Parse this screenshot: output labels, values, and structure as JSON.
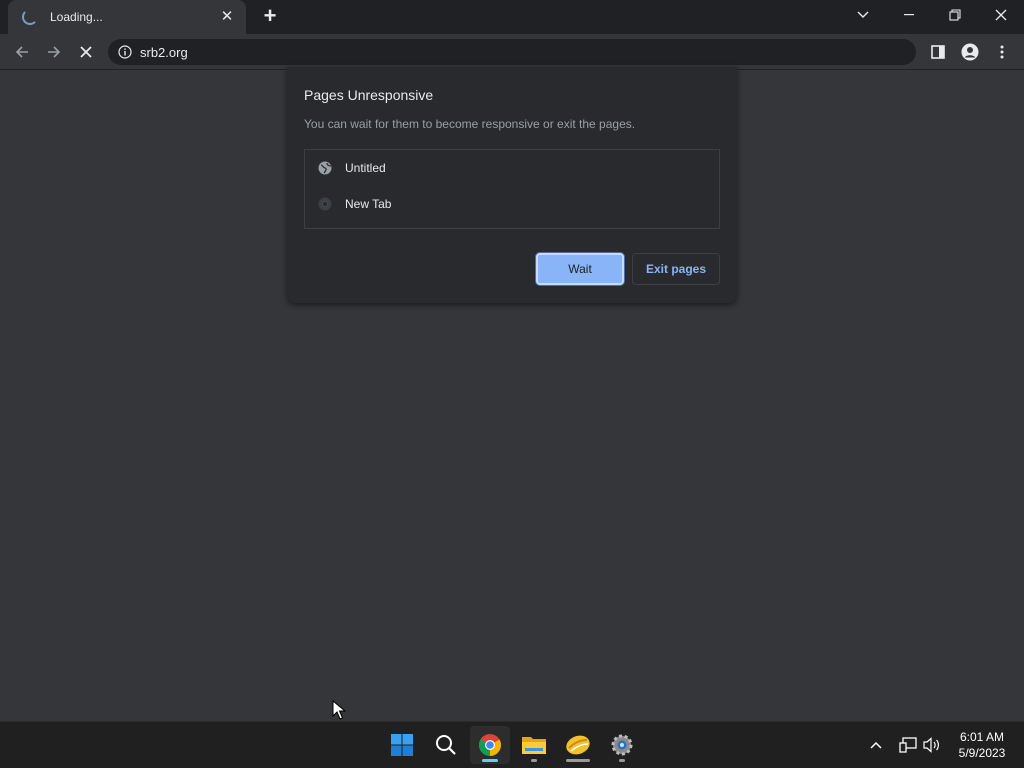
{
  "browser": {
    "tab": {
      "title": "Loading...",
      "close": "✕"
    },
    "new_tab": "+",
    "address": {
      "url": "srb2.org"
    }
  },
  "dialog": {
    "title": "Pages Unresponsive",
    "message": "You can wait for them to become responsive or exit the pages.",
    "pages": [
      {
        "label": "Untitled"
      },
      {
        "label": "New Tab"
      }
    ],
    "wait_label": "Wait",
    "exit_label": "Exit pages"
  },
  "taskbar": {
    "clock": {
      "time": "6:01 AM",
      "date": "5/9/2023"
    }
  },
  "colors": {
    "accent": "#8ab4f8",
    "page_bg": "#35363a",
    "frame_bg": "#202124",
    "dialog_bg": "#292a2d"
  }
}
